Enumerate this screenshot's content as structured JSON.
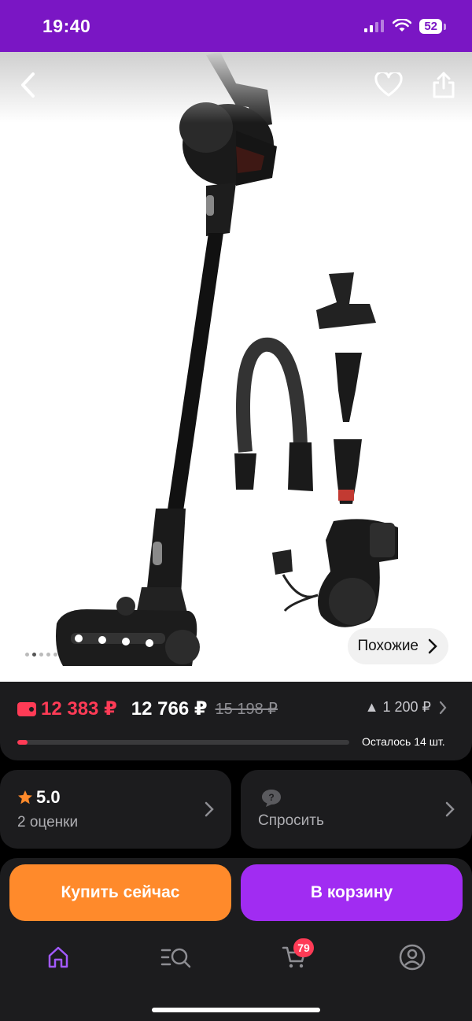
{
  "status_bar": {
    "time": "19:40",
    "battery": "52"
  },
  "gallery": {
    "similar_label": "Похожие",
    "page_count": 5,
    "active_index": 1
  },
  "price": {
    "card_price": "12 383 ₽",
    "regular_price": "12 766 ₽",
    "old_price": "15 198 ₽",
    "bonus": "1 200 ₽",
    "stock_text": "Осталось 14 шт.",
    "stock_progress": 0.03
  },
  "rating": {
    "value": "5.0",
    "count_label": "2 оценки"
  },
  "ask": {
    "label": "Спросить"
  },
  "actions": {
    "buy_now": "Купить сейчас",
    "add_to_cart": "В корзину"
  },
  "tab_bar": {
    "cart_badge": "79"
  },
  "colors": {
    "brand": "#7a16c4",
    "price": "#ff3b56",
    "buy": "#ff8a2b",
    "cart": "#a12cf2"
  },
  "icons": [
    "back-arrow-icon",
    "heart-icon",
    "share-icon",
    "wallet-icon",
    "star-icon",
    "chat-icon",
    "home-icon",
    "catalog-search-icon",
    "cart-icon",
    "profile-icon"
  ]
}
